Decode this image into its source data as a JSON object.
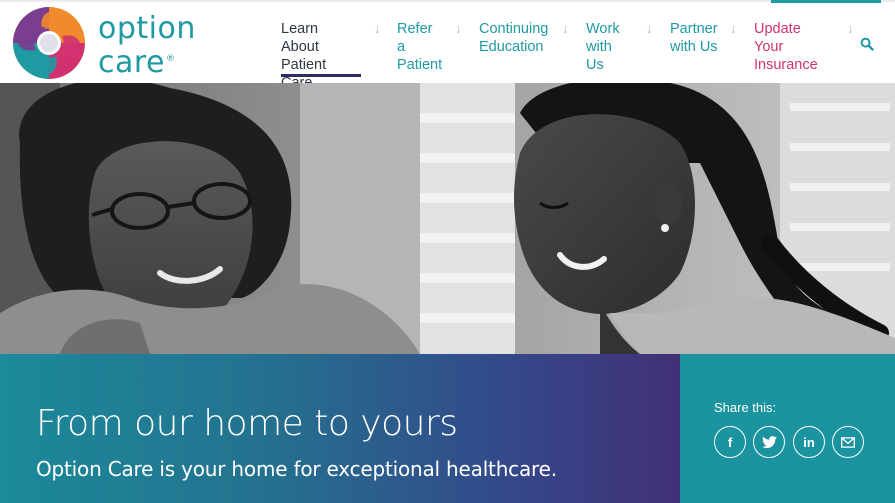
{
  "brand": {
    "name_line1": "option",
    "name_line2": "care",
    "registered": "®",
    "color_primary": "#1f9aa3",
    "logo_colors": [
      "#d1326f",
      "#f18a2d",
      "#f3b535",
      "#1f9aa3",
      "#7b3d8f",
      "#2d2c62"
    ]
  },
  "nav": {
    "items": [
      {
        "line1": "Learn About",
        "line2": "Patient Care",
        "active": true
      },
      {
        "line1": "Refer a",
        "line2": "Patient"
      },
      {
        "line1": "Continuing",
        "line2": "Education"
      },
      {
        "line1": "Work",
        "line2": "with Us"
      },
      {
        "line1": "Partner",
        "line2": "with Us"
      },
      {
        "line1": "Update Your",
        "line2": "Insurance",
        "color": "#d1326f"
      }
    ],
    "arrow_glyph": "↓",
    "search_icon": "search-icon"
  },
  "banner": {
    "title": "From our home to yours",
    "subtitle": "Option Care is your home for exceptional healthcare."
  },
  "share": {
    "label": "Share this:",
    "buttons": [
      {
        "icon": "facebook-icon",
        "glyph": "f"
      },
      {
        "icon": "twitter-icon"
      },
      {
        "icon": "linkedin-icon",
        "glyph": "in"
      },
      {
        "icon": "email-icon"
      }
    ]
  }
}
